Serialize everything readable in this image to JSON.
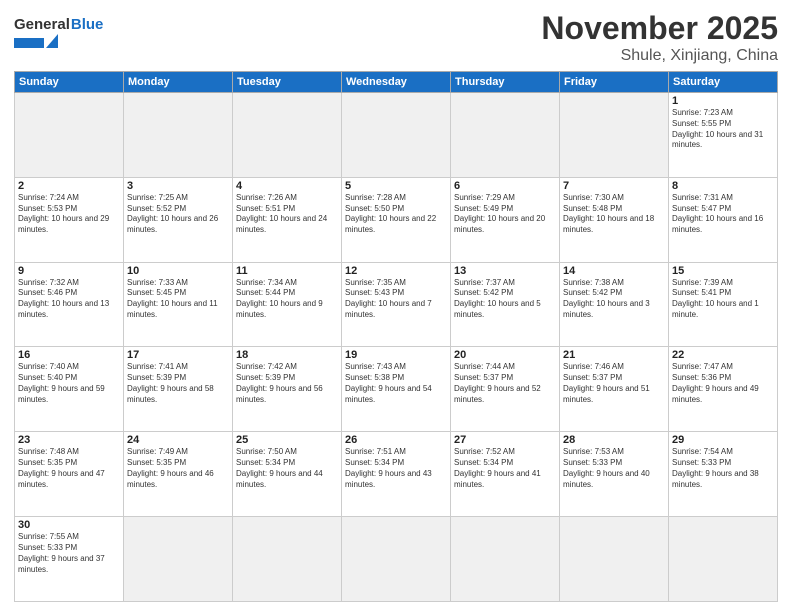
{
  "header": {
    "logo_general": "General",
    "logo_blue": "Blue",
    "title": "November 2025",
    "subtitle": "Shule, Xinjiang, China"
  },
  "days_of_week": [
    "Sunday",
    "Monday",
    "Tuesday",
    "Wednesday",
    "Thursday",
    "Friday",
    "Saturday"
  ],
  "weeks": [
    [
      {
        "day": "",
        "info": "",
        "empty": true
      },
      {
        "day": "",
        "info": "",
        "empty": true
      },
      {
        "day": "",
        "info": "",
        "empty": true
      },
      {
        "day": "",
        "info": "",
        "empty": true
      },
      {
        "day": "",
        "info": "",
        "empty": true
      },
      {
        "day": "",
        "info": "",
        "empty": true
      },
      {
        "day": "1",
        "info": "Sunrise: 7:23 AM\nSunset: 5:55 PM\nDaylight: 10 hours and 31 minutes."
      }
    ],
    [
      {
        "day": "2",
        "info": "Sunrise: 7:24 AM\nSunset: 5:53 PM\nDaylight: 10 hours and 29 minutes."
      },
      {
        "day": "3",
        "info": "Sunrise: 7:25 AM\nSunset: 5:52 PM\nDaylight: 10 hours and 26 minutes."
      },
      {
        "day": "4",
        "info": "Sunrise: 7:26 AM\nSunset: 5:51 PM\nDaylight: 10 hours and 24 minutes."
      },
      {
        "day": "5",
        "info": "Sunrise: 7:28 AM\nSunset: 5:50 PM\nDaylight: 10 hours and 22 minutes."
      },
      {
        "day": "6",
        "info": "Sunrise: 7:29 AM\nSunset: 5:49 PM\nDaylight: 10 hours and 20 minutes."
      },
      {
        "day": "7",
        "info": "Sunrise: 7:30 AM\nSunset: 5:48 PM\nDaylight: 10 hours and 18 minutes."
      },
      {
        "day": "8",
        "info": "Sunrise: 7:31 AM\nSunset: 5:47 PM\nDaylight: 10 hours and 16 minutes."
      }
    ],
    [
      {
        "day": "9",
        "info": "Sunrise: 7:32 AM\nSunset: 5:46 PM\nDaylight: 10 hours and 13 minutes."
      },
      {
        "day": "10",
        "info": "Sunrise: 7:33 AM\nSunset: 5:45 PM\nDaylight: 10 hours and 11 minutes."
      },
      {
        "day": "11",
        "info": "Sunrise: 7:34 AM\nSunset: 5:44 PM\nDaylight: 10 hours and 9 minutes."
      },
      {
        "day": "12",
        "info": "Sunrise: 7:35 AM\nSunset: 5:43 PM\nDaylight: 10 hours and 7 minutes."
      },
      {
        "day": "13",
        "info": "Sunrise: 7:37 AM\nSunset: 5:42 PM\nDaylight: 10 hours and 5 minutes."
      },
      {
        "day": "14",
        "info": "Sunrise: 7:38 AM\nSunset: 5:42 PM\nDaylight: 10 hours and 3 minutes."
      },
      {
        "day": "15",
        "info": "Sunrise: 7:39 AM\nSunset: 5:41 PM\nDaylight: 10 hours and 1 minute."
      }
    ],
    [
      {
        "day": "16",
        "info": "Sunrise: 7:40 AM\nSunset: 5:40 PM\nDaylight: 9 hours and 59 minutes."
      },
      {
        "day": "17",
        "info": "Sunrise: 7:41 AM\nSunset: 5:39 PM\nDaylight: 9 hours and 58 minutes."
      },
      {
        "day": "18",
        "info": "Sunrise: 7:42 AM\nSunset: 5:39 PM\nDaylight: 9 hours and 56 minutes."
      },
      {
        "day": "19",
        "info": "Sunrise: 7:43 AM\nSunset: 5:38 PM\nDaylight: 9 hours and 54 minutes."
      },
      {
        "day": "20",
        "info": "Sunrise: 7:44 AM\nSunset: 5:37 PM\nDaylight: 9 hours and 52 minutes."
      },
      {
        "day": "21",
        "info": "Sunrise: 7:46 AM\nSunset: 5:37 PM\nDaylight: 9 hours and 51 minutes."
      },
      {
        "day": "22",
        "info": "Sunrise: 7:47 AM\nSunset: 5:36 PM\nDaylight: 9 hours and 49 minutes."
      }
    ],
    [
      {
        "day": "23",
        "info": "Sunrise: 7:48 AM\nSunset: 5:35 PM\nDaylight: 9 hours and 47 minutes."
      },
      {
        "day": "24",
        "info": "Sunrise: 7:49 AM\nSunset: 5:35 PM\nDaylight: 9 hours and 46 minutes."
      },
      {
        "day": "25",
        "info": "Sunrise: 7:50 AM\nSunset: 5:34 PM\nDaylight: 9 hours and 44 minutes."
      },
      {
        "day": "26",
        "info": "Sunrise: 7:51 AM\nSunset: 5:34 PM\nDaylight: 9 hours and 43 minutes."
      },
      {
        "day": "27",
        "info": "Sunrise: 7:52 AM\nSunset: 5:34 PM\nDaylight: 9 hours and 41 minutes."
      },
      {
        "day": "28",
        "info": "Sunrise: 7:53 AM\nSunset: 5:33 PM\nDaylight: 9 hours and 40 minutes."
      },
      {
        "day": "29",
        "info": "Sunrise: 7:54 AM\nSunset: 5:33 PM\nDaylight: 9 hours and 38 minutes."
      }
    ],
    [
      {
        "day": "30",
        "info": "Sunrise: 7:55 AM\nSunset: 5:33 PM\nDaylight: 9 hours and 37 minutes."
      },
      {
        "day": "",
        "info": "",
        "empty": true
      },
      {
        "day": "",
        "info": "",
        "empty": true
      },
      {
        "day": "",
        "info": "",
        "empty": true
      },
      {
        "day": "",
        "info": "",
        "empty": true
      },
      {
        "day": "",
        "info": "",
        "empty": true
      },
      {
        "day": "",
        "info": "",
        "empty": true
      }
    ]
  ]
}
